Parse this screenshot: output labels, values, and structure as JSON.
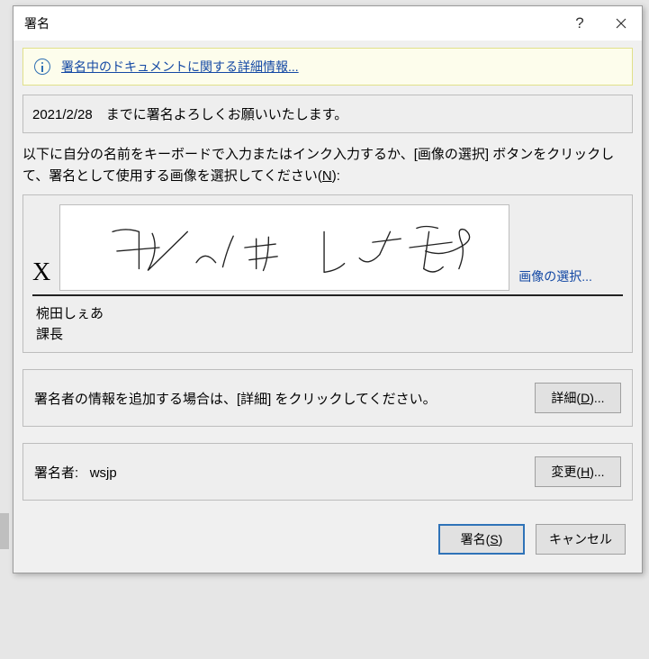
{
  "titlebar": {
    "title": "署名"
  },
  "infobar": {
    "link_text": "署名中のドキュメントに関する詳細情報..."
  },
  "note": {
    "text": "2021/2/28　までに署名よろしくお願いいたします。"
  },
  "instructions": {
    "text": "以下に自分の名前をキーボードで入力またはインク入力するか、[画像の選択] ボタンをクリックして、署名として使用する画像を選択してください(",
    "mnemonic": "N",
    "after": "):"
  },
  "signature": {
    "x_mark": "X",
    "select_image": "画像の選択...",
    "name": "椀田しぇあ",
    "title": "課長"
  },
  "details_row": {
    "text": "署名者の情報を追加する場合は、[詳細] をクリックしてください。",
    "button_prefix": "詳細(",
    "button_mn": "D",
    "button_suffix": ")..."
  },
  "signer_row": {
    "label": "署名者:",
    "value": "wsjp",
    "button_prefix": "変更(",
    "button_mn": "H",
    "button_suffix": ")..."
  },
  "footer": {
    "sign_prefix": "署名(",
    "sign_mn": "S",
    "sign_suffix": ")",
    "cancel": "キャンセル"
  }
}
